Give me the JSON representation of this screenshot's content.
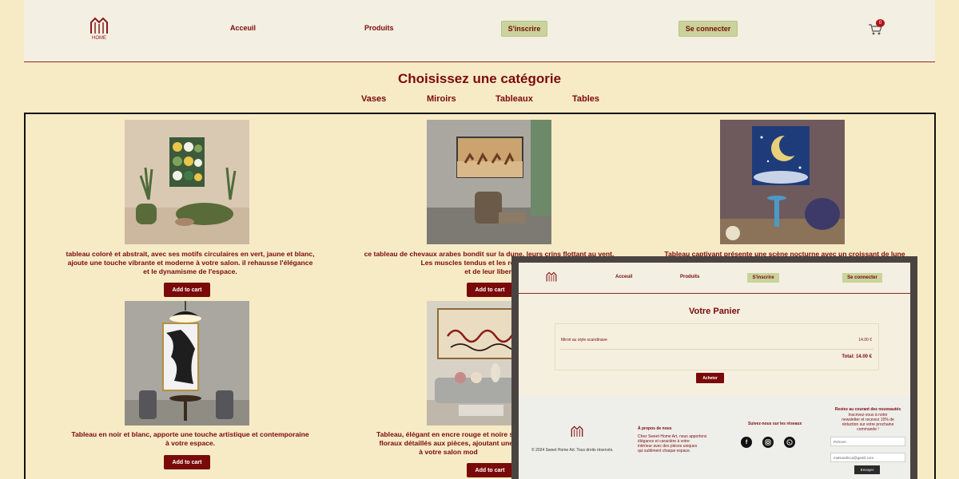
{
  "header": {
    "logo_text": "HOME",
    "nav": [
      "Acceuil",
      "Produits"
    ],
    "signup_label": "S'inscrire",
    "login_label": "Se connecter",
    "cart_count": "0"
  },
  "categories": {
    "title": "Choisissez une catégorie",
    "items": [
      "Vases",
      "Miroirs",
      "Tableaux",
      "Tables"
    ]
  },
  "products": [
    {
      "lines": [
        "tableau coloré et abstrait, avec ses motifs circulaires en vert, jaune et blanc,",
        "ajoute une touche vibrante et moderne à votre salon. il rehausse l'élégance",
        "et le dynamisme de l'espace."
      ],
      "button": "Add to cart"
    },
    {
      "lines": [
        "ce tableau de chevaux arabes bondit sur la dune, leurs crins flottant au vent.",
        "Les muscles tendus et les regards fiers té",
        "et de leur libert"
      ],
      "button": "Add to cart"
    },
    {
      "lines": [
        "Tableau captivant présente une scène nocturne avec un croissant de lune"
      ],
      "button": ""
    },
    {
      "lines": [
        "Tableau en noir et blanc, apporte une touche artistique et contemporaine",
        "à votre espace."
      ],
      "button": "Add to cart"
    },
    {
      "lines": [
        "Tableau, élégant en encre rouge et noire sur",
        "floraux détaillés aux pièces, ajoutant une t",
        "à votre salon mod"
      ],
      "button": "Add to cart"
    }
  ],
  "cart_overlay": {
    "nav": [
      "Acceuil",
      "Produits"
    ],
    "signup_label": "S'inscrire",
    "login_label": "Se connecter",
    "title": "Votre Panier",
    "item_name": "Miroir au style scandinave",
    "item_price": "14.00 €",
    "total": "Total: 14.00 €",
    "buy_label": "Acheter",
    "footer": {
      "copyright": "© 2024 Sweet Home Art. Tous droits réservés.",
      "about_title": "À propos de nous",
      "about_lines": [
        "Chez Sweet Home Art, nous apportons",
        "élégance et caractère à votre",
        "intérieur avec des pièces uniques",
        "qui subliment chaque espace."
      ],
      "social_title": "Suivez-nous sur les réseaux",
      "news_title": "Restez au courant des nouveautés",
      "news_lines": [
        "Inscrivez-vous à notre",
        "newsletter et recevez 10% de",
        "réduction sur votre prochaine",
        "commande !"
      ],
      "firstname_placeholder": "Prénom",
      "email_value": "malsoedicca@gamil.com",
      "send_label": "Envoyer"
    }
  },
  "colors": {
    "page_bg": "#f7ebc6",
    "header_bg": "#f3efe2",
    "brand": "#7a0a0a",
    "button_green": "#c9d39b"
  }
}
